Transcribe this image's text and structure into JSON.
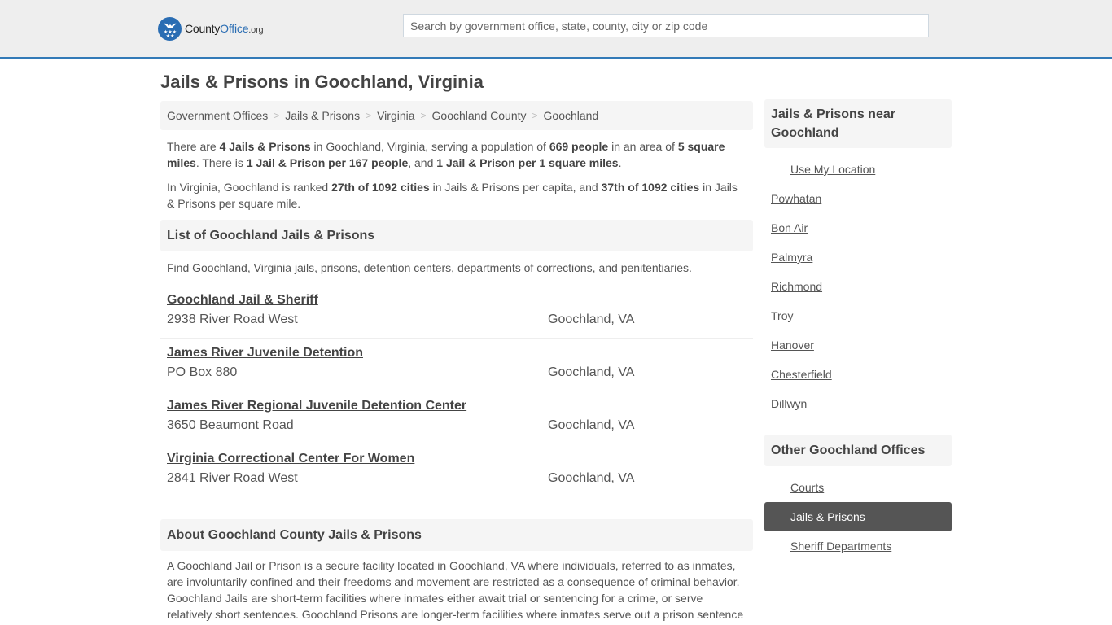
{
  "header": {
    "logo": {
      "part1": "County",
      "part2": "Office",
      "part3": ".org"
    },
    "search_placeholder": "Search by government office, state, county, city or zip code",
    "accent_color": "#337ab7"
  },
  "page_title": "Jails & Prisons in Goochland, Virginia",
  "breadcrumb": [
    "Government Offices",
    "Jails & Prisons",
    "Virginia",
    "Goochland County",
    "Goochland"
  ],
  "intro": {
    "p1": {
      "t1": "There are ",
      "b1": "4 Jails & Prisons",
      "t2": " in Goochland, Virginia, serving a population of ",
      "b2": "669 people",
      "t3": " in an area of ",
      "b3": "5 square miles",
      "t4": ". There is ",
      "b4": "1 Jail & Prison per 167 people",
      "t5": ", and ",
      "b5": "1 Jail & Prison per 1 square miles",
      "t6": "."
    },
    "p2": {
      "t1": "In Virginia, Goochland is ranked ",
      "b1": "27th of 1092 cities",
      "t2": " in Jails & Prisons per capita, and ",
      "b2": "37th of 1092 cities",
      "t3": " in Jails & Prisons per square mile."
    }
  },
  "list_section": {
    "heading": "List of Goochland Jails & Prisons",
    "description": "Find Goochland, Virginia jails, prisons, detention centers, departments of corrections, and penitentiaries.",
    "items": [
      {
        "name": "Goochland Jail & Sheriff",
        "address": "2938 River Road West",
        "city": "Goochland, VA"
      },
      {
        "name": "James River Juvenile Detention",
        "address": "PO Box 880",
        "city": "Goochland, VA"
      },
      {
        "name": "James River Regional Juvenile Detention Center",
        "address": "3650 Beaumont Road",
        "city": "Goochland, VA"
      },
      {
        "name": "Virginia Correctional Center For Women",
        "address": "2841 River Road West",
        "city": "Goochland, VA"
      }
    ]
  },
  "about_section": {
    "heading": "About Goochland County Jails & Prisons",
    "text": "A Goochland Jail or Prison is a secure facility located in Goochland, VA where individuals, referred to as inmates, are involuntarily confined and their freedoms and movement are restricted as a consequence of criminal behavior. Goochland Jails are short-term facilities where inmates either await trial or sentencing for a crime, or serve relatively short sentences. Goochland Prisons are longer-term facilities where inmates serve out a prison sentence"
  },
  "sidebar": {
    "nearby_heading": "Jails & Prisons near Goochland",
    "use_location": "Use My Location",
    "nearby": [
      "Powhatan",
      "Bon Air",
      "Palmyra",
      "Richmond",
      "Troy",
      "Hanover",
      "Chesterfield",
      "Dillwyn"
    ],
    "other_heading": "Other Goochland Offices",
    "other": [
      {
        "label": "Courts",
        "active": false
      },
      {
        "label": "Jails & Prisons",
        "active": true
      },
      {
        "label": "Sheriff Departments",
        "active": false
      }
    ]
  }
}
